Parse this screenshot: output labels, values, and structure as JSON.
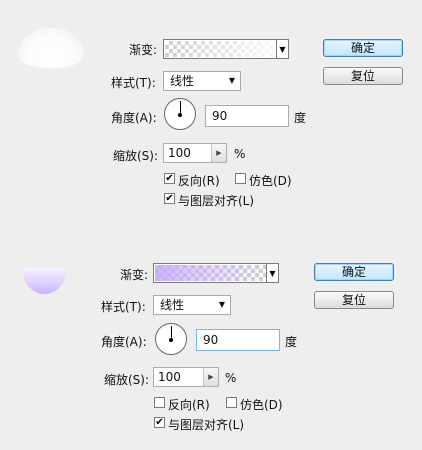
{
  "panel1": {
    "gradient_label": "渐变:",
    "gradient_colors": [
      "#ffffff",
      "#e9e9e9"
    ],
    "style_label": "样式(T):",
    "style_value": "线性",
    "angle_label": "角度(A):",
    "angle_value": "90",
    "angle_unit": "度",
    "scale_label": "缩放(S):",
    "scale_value": "100",
    "scale_unit": "%",
    "reverse_label": "反向(R)",
    "reverse_checked": true,
    "dither_label": "仿色(D)",
    "dither_checked": false,
    "align_label": "与图层对齐(L)",
    "align_checked": true,
    "ok_label": "确定",
    "reset_label": "复位"
  },
  "panel2": {
    "gradient_label": "渐变:",
    "gradient_colors": [
      "#c6a6ff",
      "#ffffff"
    ],
    "style_label": "样式(T):",
    "style_value": "线性",
    "angle_label": "角度(A):",
    "angle_value": "90",
    "angle_unit": "度",
    "scale_label": "缩放(S):",
    "scale_value": "100",
    "scale_unit": "%",
    "reverse_label": "反向(R)",
    "reverse_checked": false,
    "dither_label": "仿色(D)",
    "dither_checked": false,
    "align_label": "与图层对齐(L)",
    "align_checked": true,
    "ok_label": "确定",
    "reset_label": "复位"
  },
  "icons": {
    "dropdown": "chevron-down-icon",
    "spin": "triangle-right-icon",
    "check": "checkmark-icon"
  }
}
